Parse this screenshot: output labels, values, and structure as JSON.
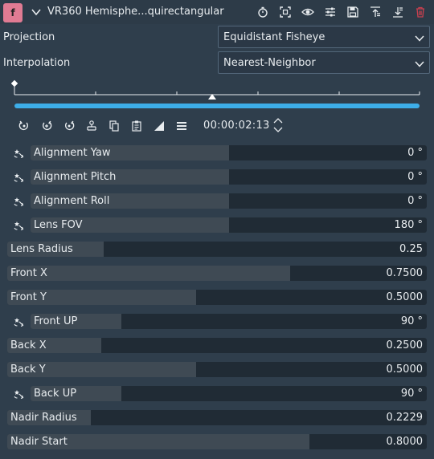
{
  "header": {
    "badge": "f",
    "title": "VR360 Hemisphe...quirectangular",
    "icons": [
      "collapse-chevron-icon",
      "timer-icon",
      "fullscreen-icon",
      "eye-icon",
      "sliders-icon",
      "save-icon",
      "move-up-icon",
      "move-down-icon",
      "delete-icon"
    ],
    "delete_color": "#c8404f"
  },
  "projection": {
    "label": "Projection",
    "value": "Equidistant Fisheye"
  },
  "interpolation": {
    "label": "Interpolation",
    "value": "Nearest-Neighbor"
  },
  "timeline": {
    "progress_color": "#3daee9"
  },
  "toolbar": {
    "icons": [
      "previous-keyframe-icon",
      "add-keyframe-icon",
      "next-keyframe-icon",
      "keyframe-type-icon",
      "copy-icon",
      "paste-icon",
      "curve-icon",
      "menu-icon"
    ],
    "timecode": "00:00:02:13"
  },
  "params": [
    {
      "name": "Alignment Yaw",
      "value": "0 °",
      "keyframable": true,
      "level": 0.5
    },
    {
      "name": "Alignment Pitch",
      "value": "0 °",
      "keyframable": true,
      "level": 0.5
    },
    {
      "name": "Alignment Roll",
      "value": "0 °",
      "keyframable": true,
      "level": 0.5
    },
    {
      "name": "Lens FOV",
      "value": "180 °",
      "keyframable": true,
      "level": 0.5
    },
    {
      "name": "Lens Radius",
      "value": "0.25",
      "keyframable": false,
      "level": 0.23
    },
    {
      "name": "Front X",
      "value": "0.7500",
      "keyframable": false,
      "level": 0.675
    },
    {
      "name": "Front Y",
      "value": "0.5000",
      "keyframable": false,
      "level": 0.45
    },
    {
      "name": "Front UP",
      "value": "90 °",
      "keyframable": true,
      "level": 0.23
    },
    {
      "name": "Back X",
      "value": "0.2500",
      "keyframable": false,
      "level": 0.225
    },
    {
      "name": "Back Y",
      "value": "0.5000",
      "keyframable": false,
      "level": 0.45
    },
    {
      "name": "Back UP",
      "value": "90 °",
      "keyframable": true,
      "level": 0.23
    },
    {
      "name": "Nadir Radius",
      "value": "0.2229",
      "keyframable": false,
      "level": 0.2
    },
    {
      "name": "Nadir Start",
      "value": "0.8000",
      "keyframable": false,
      "level": 0.72
    }
  ]
}
